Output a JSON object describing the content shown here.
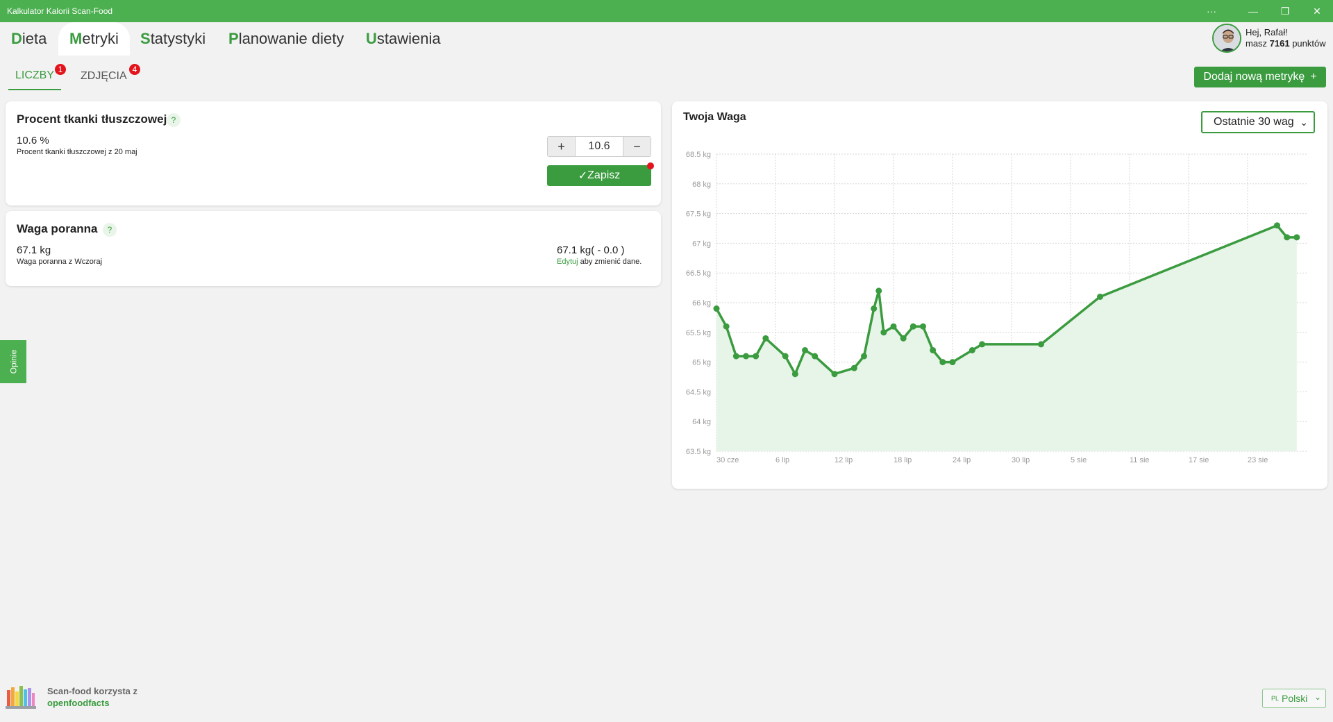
{
  "window": {
    "title": "Kalkulator Kalorii Scan-Food",
    "more": "···",
    "minimize": "—",
    "restore": "❐",
    "close": "✕"
  },
  "nav": {
    "items": [
      {
        "first": "D",
        "rest": "ieta"
      },
      {
        "first": "M",
        "rest": "etryki"
      },
      {
        "first": "S",
        "rest": "tatystyki"
      },
      {
        "first": "P",
        "rest": "lanowanie diety"
      },
      {
        "first": "U",
        "rest": "stawienia"
      }
    ],
    "active_index": 1
  },
  "user": {
    "greeting": "Hej, Rafał!",
    "points_prefix": "masz ",
    "points": "7161",
    "points_suffix": " punktów"
  },
  "subtabs": [
    {
      "label": "LICZBY",
      "badge": "1"
    },
    {
      "label": "ZDJĘCIA",
      "badge": "4"
    }
  ],
  "add_metric_label": "Dodaj nową metrykę",
  "add_metric_icon": "+",
  "cards": {
    "fat": {
      "title": "Procent tkanki tłuszczowej",
      "help": "?",
      "value": "10.6 %",
      "caption": "Procent tkanki tłuszczowej z 20 maj",
      "stepper_plus": "+",
      "stepper_value": "10.6",
      "stepper_minus": "−",
      "save_label": "Zapisz",
      "save_icon": "✓"
    },
    "weight": {
      "title": "Waga poranna",
      "help": "?",
      "value": "67.1 kg",
      "caption": "Waga poranna z Wczoraj",
      "right_value": "67.1 kg( - 0.0 )",
      "edit_link": "Edytuj",
      "edit_suffix": " aby zmienić dane."
    }
  },
  "opinie_label": "Opinie",
  "chart": {
    "title": "Twoja Waga",
    "range_select": "Ostatnie 30 wag",
    "caret": "⌄"
  },
  "chart_data": {
    "type": "area",
    "title": "Twoja Waga",
    "x_tick_labels": [
      "30 cze",
      "6 lip",
      "12 lip",
      "18 lip",
      "24 lip",
      "30 lip",
      "5 sie",
      "11 sie",
      "17 sie",
      "23 sie"
    ],
    "y_tick_labels": [
      "68.5 kg",
      "68 kg",
      "67.5 kg",
      "67 kg",
      "66.5 kg",
      "66 kg",
      "65.5 kg",
      "65 kg",
      "64.5 kg",
      "64 kg",
      "63.5 kg"
    ],
    "ylim": [
      63.5,
      68.5
    ],
    "y_unit": "kg",
    "grid": true,
    "line_color": "#3a9b3f",
    "fill_color": "#e7f4e8",
    "x_day_offsets": [
      0,
      1,
      2,
      3,
      4,
      5,
      7,
      8,
      9,
      10,
      12,
      14,
      15,
      16,
      16.5,
      17,
      18,
      19,
      20,
      21,
      22,
      23,
      24,
      26,
      27,
      33,
      39,
      57,
      58,
      59
    ],
    "series": [
      {
        "values": [
          65.9,
          65.6,
          65.1,
          65.1,
          65.1,
          65.4,
          65.1,
          64.8,
          65.2,
          65.1,
          64.8,
          64.9,
          65.1,
          65.9,
          66.2,
          65.5,
          65.6,
          65.4,
          65.6,
          65.6,
          65.2,
          65.0,
          65.0,
          65.2,
          65.3,
          65.3,
          66.1,
          67.3,
          67.1,
          67.1
        ]
      }
    ]
  },
  "footer": {
    "line1": "Scan-food korzysta z",
    "line2": "openfoodfacts"
  },
  "language": {
    "code": "PL",
    "label": "Polski",
    "caret": "⌄"
  }
}
